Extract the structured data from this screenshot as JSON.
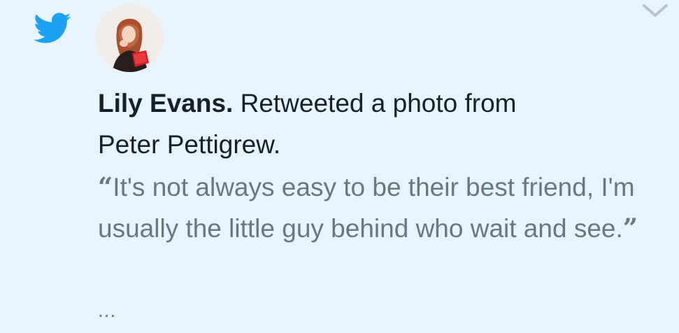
{
  "notification": {
    "author": "Lily Evans.",
    "action_text": "Retweeted a photo from",
    "source_user": "Peter Pettigrew.",
    "quote_open": "“",
    "quote_text": "It's not always easy to be their best friend, I'm usually the little guy behind who wait and see.",
    "quote_close": "”",
    "ellipsis": "..."
  },
  "icons": {
    "app_logo": "twitter-bird-icon",
    "menu": "chevron-down-icon"
  },
  "colors": {
    "background": "#e8f4fd",
    "brand_blue": "#1da1f2",
    "primary_text": "#15202b",
    "secondary_text": "#647887",
    "chevron": "#b8c2cc"
  }
}
